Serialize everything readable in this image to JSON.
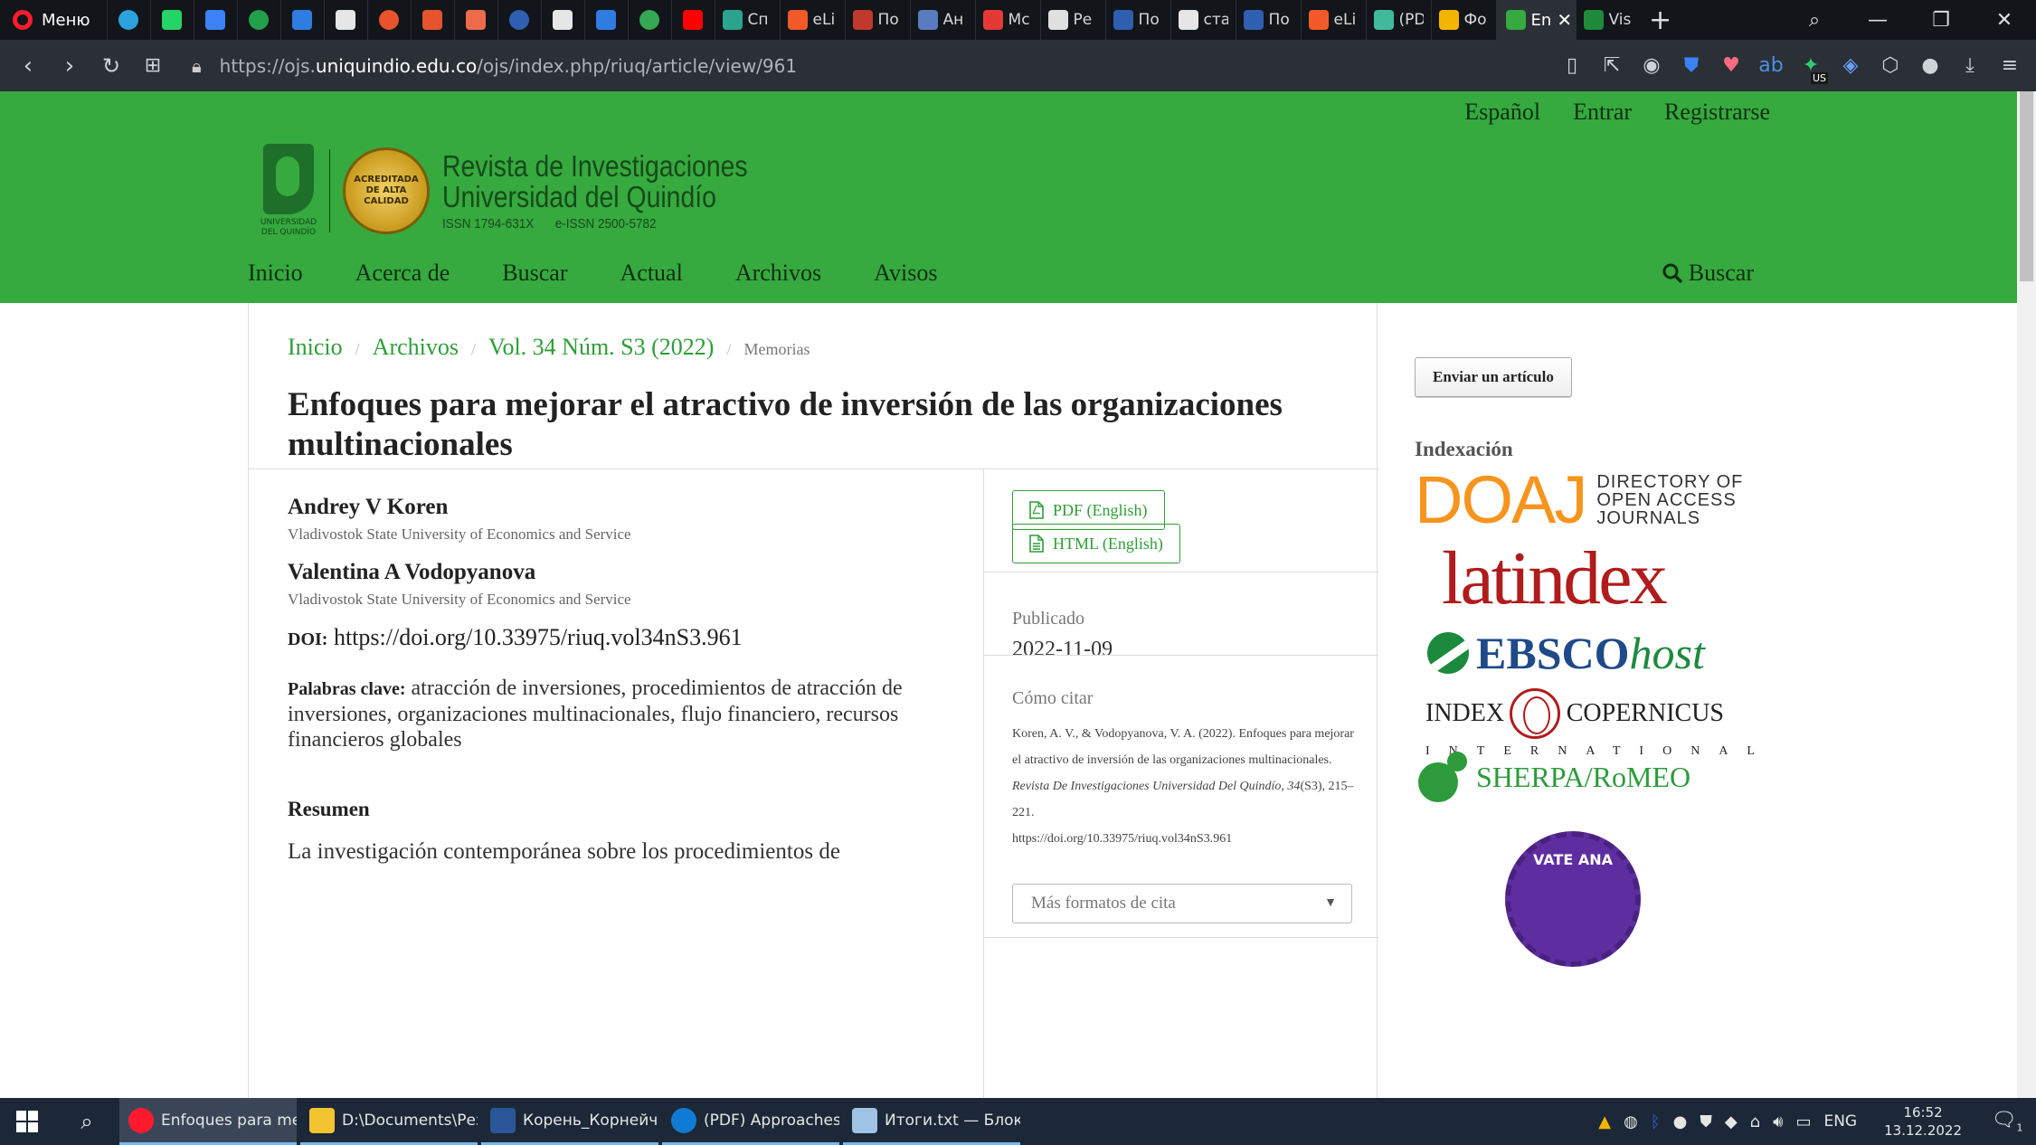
{
  "browser": {
    "menu_label": "Меню",
    "pinned_tabs": [
      {
        "icon": "telegram-icon",
        "color": "#2aa3df"
      },
      {
        "icon": "whatsapp-icon",
        "color": "#25d366"
      },
      {
        "icon": "messenger-icon",
        "color": "#3b82f6"
      },
      {
        "icon": "plus-box-icon",
        "color": "#22a04b"
      },
      {
        "icon": "stack-icon",
        "color": "#2f7de1"
      },
      {
        "icon": "globe-icon",
        "color": "#e6e6e6"
      },
      {
        "icon": "jet-icon",
        "color": "#e6532c"
      },
      {
        "icon": "jet-icon",
        "color": "#e6532c"
      },
      {
        "icon": "rocket-icon",
        "color": "#ef6c4b"
      },
      {
        "icon": "ssrn-icon",
        "color": "#2e5fb0"
      },
      {
        "icon": "tt-icon",
        "color": "#e6e6e6"
      },
      {
        "icon": "figure-icon",
        "color": "#2f7de1"
      },
      {
        "icon": "maps-icon",
        "color": "#34a853"
      },
      {
        "icon": "youtube-icon",
        "color": "#ff0000"
      }
    ],
    "labeled_tabs": [
      {
        "label": "Сп",
        "color": "#2aa38f"
      },
      {
        "label": "eLi",
        "color": "#f25a29"
      },
      {
        "label": "По",
        "color": "#c0392b"
      },
      {
        "label": "Ан",
        "color": "#5a7bbf"
      },
      {
        "label": "Мс",
        "color": "#e53935"
      },
      {
        "label": "Ре",
        "color": "#e0e0e0"
      },
      {
        "label": "По",
        "color": "#2e5fb0"
      },
      {
        "label": "ста",
        "color": "#e6e6e6"
      },
      {
        "label": "По",
        "color": "#2e5fb0"
      },
      {
        "label": "eLi",
        "color": "#f25a29"
      },
      {
        "label": "(PD",
        "color": "#40ba9b"
      },
      {
        "label": "Фо",
        "color": "#f4b400"
      }
    ],
    "active_tab": {
      "label": "En",
      "color": "#36a93f"
    },
    "last_tab": {
      "label": "Vis",
      "color": "#1e8a3a"
    },
    "url_prefix": "https://ojs.",
    "url_domain": "uniquindio.edu.co",
    "url_path": "/ojs/index.php/riuq/article/view/961",
    "ext_badge": "US"
  },
  "header": {
    "user_nav": [
      "Español",
      "Entrar",
      "Registrarse"
    ],
    "uq_caption": "UNIVERSIDAD\nDEL QUINDÍO",
    "seal_text": "ACREDITADA\nDE ALTA\nCALIDAD",
    "journal_line1": "Revista de Investigaciones",
    "journal_line2": "Universidad del Quindío",
    "issn": "ISSN 1794-631X",
    "eissn": "e-ISSN 2500-5782",
    "primary_nav": [
      "Inicio",
      "Acerca de",
      "Buscar",
      "Actual",
      "Archivos",
      "Avisos"
    ],
    "search_label": "Buscar"
  },
  "article": {
    "breadcrumb": {
      "home": "Inicio",
      "archives": "Archivos",
      "issue": "Vol. 34 Núm. S3 (2022)",
      "section": "Memorias"
    },
    "title": "Enfoques para mejorar el atractivo de inversión de las organizaciones multinacionales",
    "authors": [
      {
        "name": "Andrey V Koren",
        "affiliation": "Vladivostok State University of Economics and Service"
      },
      {
        "name": "Valentina A Vodopyanova",
        "affiliation": "Vladivostok State University of Economics and Service"
      }
    ],
    "doi_label": "DOI:",
    "doi": "https://doi.org/10.33975/riuq.vol34nS3.961",
    "keywords_label": "Palabras clave:",
    "keywords": "atracción de inversiones, procedimientos de atracción de inversiones, organizaciones multinacionales, flujo financiero, recursos financieros globales",
    "abstract_label": "Resumen",
    "abstract_start": "La investigación contemporánea sobre los procedimientos de",
    "galleys": [
      "PDF (English)",
      "HTML (English)"
    ],
    "published_label": "Publicado",
    "published_date": "2022-11-09",
    "cite_label": "Cómo citar",
    "citation_authors": "Koren, A. V., & Vodopyanova, V. A. (2022). Enfoques para mejorar el atractivo de inversión de las organizaciones multinacionales.",
    "citation_journal": "Revista De Investigaciones Universidad Del Quindío, 34",
    "citation_rest": "(S3), 215–221.",
    "citation_doi": "https://doi.org/10.33975/riuq.vol34nS3.961",
    "cite_formats_label": "Más formatos de cita"
  },
  "sidebar": {
    "submit_label": "Enviar un artículo",
    "indexing_title": "Indexación",
    "doaj_big": "DOAJ",
    "doaj_small": "DIRECTORY OF\nOPEN ACCESS\nJOURNALS",
    "latindex": "latindex",
    "ebsco_bold": "EBSCO",
    "ebsco_italic": "host",
    "copernicus_left": "INDEX",
    "copernicus_right": "COPERNICUS",
    "copernicus_intl": "INTERNATIONAL",
    "sherpa": "SHERPA/RoMEO",
    "private_badge": "VATE ANA"
  },
  "taskbar": {
    "apps": [
      {
        "label": "Enfoques para mej...",
        "color": "#ff1b2d",
        "active": true
      },
      {
        "label": "D:\\Documents\\Резе...",
        "color": "#f4c430",
        "active": false
      },
      {
        "label": "Корень_Корнейчук...",
        "color": "#2b579a",
        "active": false
      },
      {
        "label": "(PDF) Approaches t...",
        "color": "#0f7bd4",
        "active": false
      },
      {
        "label": "Итоги.txt — Блокнот",
        "color": "#9ec3e6",
        "active": false
      }
    ],
    "lang": "ENG",
    "time": "16:52",
    "date": "13.12.2022",
    "notifications": "1"
  }
}
